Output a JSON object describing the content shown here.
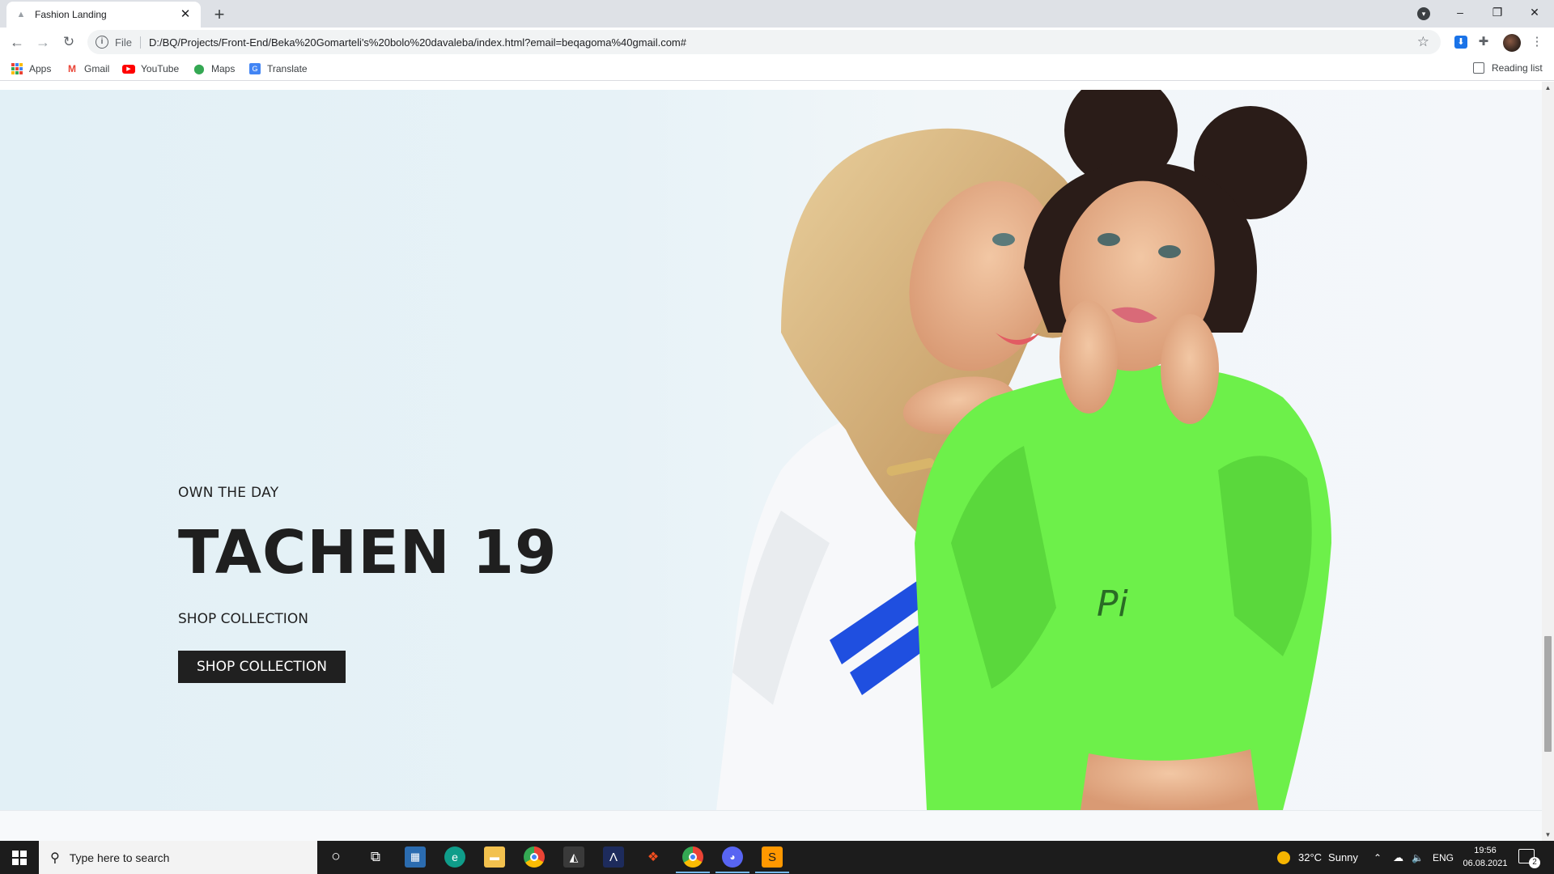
{
  "browser": {
    "tab": {
      "title": "Fashion Landing",
      "close": "✕"
    },
    "new_tab": "+",
    "window_controls": {
      "minimize": "–",
      "restore": "❐",
      "close": "✕"
    },
    "address": {
      "scheme_label": "File",
      "url": "D:/BQ/Projects/Front-End/Beka%20Gomarteli's%20bolo%20davaleba/index.html?email=beqagoma%40gmail.com#"
    },
    "bookmarks": [
      {
        "label": "Apps",
        "icon": "apps-grid-icon"
      },
      {
        "label": "Gmail",
        "icon": "gmail-icon"
      },
      {
        "label": "YouTube",
        "icon": "youtube-icon"
      },
      {
        "label": "Maps",
        "icon": "maps-pin-icon"
      },
      {
        "label": "Translate",
        "icon": "translate-icon"
      }
    ],
    "reading_list": "Reading list"
  },
  "hero": {
    "kicker": "OWN THE DAY",
    "headline": "TACHEN 19",
    "subheading": "SHOP COLLECTION",
    "cta_label": "SHOP COLLECTION",
    "colors": {
      "background": "#e4f1f7",
      "text": "#1f1f1f",
      "button": "#202020",
      "green_hoodie": "#6df04a",
      "stripe_blue": "#1f4fe0"
    }
  },
  "taskbar": {
    "search_placeholder": "Type here to search",
    "apps": [
      "cortana-icon",
      "task-view-icon",
      "calculator-icon",
      "edge-icon",
      "file-explorer-icon",
      "chrome-icon",
      "inkscape-icon",
      "affinity-icon",
      "figma-icon",
      "chrome-active-icon",
      "discord-icon",
      "sublime-icon"
    ],
    "weather": {
      "temp": "32°C",
      "condition": "Sunny"
    },
    "language": "ENG",
    "time": "19:56",
    "date": "06.08.2021",
    "notification_count": "2"
  }
}
